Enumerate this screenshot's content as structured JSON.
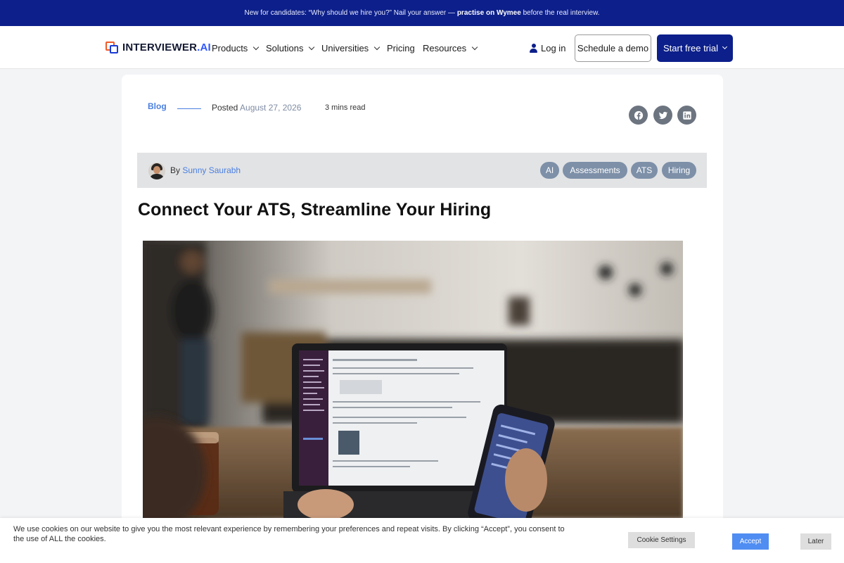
{
  "announcement": {
    "prefix": "New for candidates: “Why should we hire you?” Nail your answer — ",
    "emphasis": "practise on Wymee",
    "suffix": " before the real interview."
  },
  "header": {
    "logo_main": "INTERVIEWER",
    "logo_accent": ".AI",
    "nav": [
      {
        "label": "Products",
        "has_dropdown": true
      },
      {
        "label": "Solutions",
        "has_dropdown": true
      },
      {
        "label": "Universities",
        "has_dropdown": true
      },
      {
        "label": "Pricing",
        "has_dropdown": false
      },
      {
        "label": "Resources",
        "has_dropdown": true
      }
    ],
    "login_label": "Log in",
    "demo_label": "Schedule a demo",
    "trial_label": "Start free trial"
  },
  "post": {
    "category": "Blog",
    "posted_label": "Posted",
    "date": "August 27, 2026",
    "read_time": "3 mins read",
    "share": [
      {
        "icon": "facebook-icon"
      },
      {
        "icon": "twitter-icon"
      },
      {
        "icon": "linkedin-icon"
      }
    ],
    "by_label": "By",
    "author": "Sunny Saurabh",
    "tags": [
      "AI",
      "Assessments",
      "ATS",
      "Hiring"
    ],
    "title": "Connect Your ATS, Streamline Your Hiring"
  },
  "cookie": {
    "text": "We use cookies on our website to give you the most relevant experience by remembering your preferences and repeat visits. By clicking “Accept”, you consent to the use of ALL the cookies.",
    "settings_label": "Cookie Settings",
    "accept_label": "Accept",
    "later_label": "Later"
  },
  "colors": {
    "brand_navy": "#0c1f8a",
    "link_blue": "#4a7fe0",
    "tag_bg": "#7d90a8",
    "accept_blue": "#4f8df2"
  }
}
